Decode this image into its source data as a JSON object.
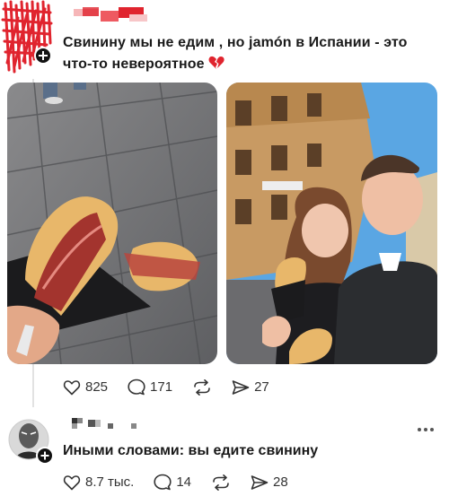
{
  "post": {
    "text_line1": "Свинину мы не едим , но jamón в Испании - это",
    "text_line2": "что-то невероятное",
    "likes": "825",
    "comments": "171",
    "shares": "27"
  },
  "reply": {
    "text": "Иными словами: вы едите свинину",
    "likes": "8.7 тыс.",
    "comments": "14",
    "shares": "28"
  },
  "colors": {
    "icon": "#333333",
    "censor_red": "#e0242e"
  }
}
